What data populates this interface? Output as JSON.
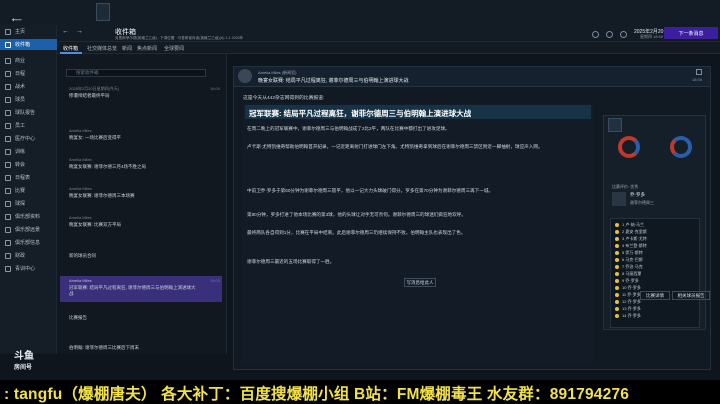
{
  "topbar": {
    "title": "收件箱",
    "subtitle": "克鲁斯菲尔德(英格兰乙级) - 下调位置 · 马鲁斯宣传者(英格兰乙级)(A) 1-1 2025年",
    "date": "2025年2月20日",
    "day": "星期四 18:00",
    "continue_label": "下一条消息"
  },
  "sidebar": {
    "items": [
      {
        "label": "主页"
      },
      {
        "label": "收件箱"
      },
      {
        "label": "商业"
      },
      {
        "label": "日程"
      },
      {
        "label": "战术"
      },
      {
        "label": "球员"
      },
      {
        "label": "球队报告"
      },
      {
        "label": "员工"
      },
      {
        "label": "医疗中心"
      },
      {
        "label": "训练"
      },
      {
        "label": "转会"
      },
      {
        "label": "日程表"
      },
      {
        "label": "比赛"
      },
      {
        "label": "球探"
      },
      {
        "label": "俱乐部资料"
      },
      {
        "label": "俱乐部远景"
      },
      {
        "label": "俱乐部信息"
      },
      {
        "label": "财政"
      },
      {
        "label": "青训中心"
      }
    ]
  },
  "tabs": [
    {
      "label": "收件箱"
    },
    {
      "label": "社交媒体总览"
    },
    {
      "label": "新闻"
    },
    {
      "label": "焦点新闻"
    },
    {
      "label": "全球要闻"
    }
  ],
  "list": {
    "search_placeholder": "搜索收件箱",
    "mails": [
      {
        "from": "2025年2月20日星期四(今天)",
        "subject": "惨遭缔结者最终平局",
        "time": "18:00"
      },
      {
        "from": "Amelia Miles",
        "subject": "晚宴女: 一场比赛后变得平",
        "time": ""
      },
      {
        "from": "Amelia Miles",
        "subject": "晚宴女联赛: 谢菲尔德三月4场不胜之局",
        "time": ""
      },
      {
        "from": "Amelia Miles",
        "subject": "晚宴女联赛: 谢菲尔德周三本场赛",
        "time": ""
      },
      {
        "from": "Amelia Miles",
        "subject": "晚宴女联赛: 比赛双方平局",
        "time": ""
      },
      {
        "from": "",
        "subject": "新的球员合同",
        "time": ""
      },
      {
        "from": "Amelia Miles",
        "subject": "冠军联赛: 结局平凡过程离狂, 谢菲尔德周三与伯明翰上演进球大战",
        "time": "18:00"
      },
      {
        "from": "",
        "subject": "比赛报告",
        "time": ""
      },
      {
        "from": "",
        "subject": "伯明翰: 谢菲尔德周三比赛后下周末",
        "time": ""
      }
    ]
  },
  "viewer": {
    "from": "Amelia Miles (新闻官)",
    "subject": "晚宴女联赛: 结局平凡过程离狂, 谢菲尔德周三与伯明翰上演进球大战",
    "time": "18:00",
    "intro": "这是今天从442杂志网得到的比赛报道:",
    "title": "冠军联赛: 结局平凡过程离狂，谢菲尔德周三与伯明翰上演进球大战",
    "paragraphs": [
      "在周二晚上的冠军联赛中，谢菲尔德周三与伯明翰战成了2比2平，两队在比赛中都打出了进攻足球。",
      "卢卡斯·尤特凯维奇帮助伯明翰首开纪录，一记近距离射门打进球门左下角。尤特凯维奇拿到球后在谢菲尔德周三禁区附近一脚抽射，球应声入网。",
      "中前卫乔·罗多于第60分钟为谢菲尔德周三扳平，他以一记大力头球破门得分。罗多在第70分钟为谢菲尔德周三再下一城。",
      "第80分钟，罗多打进了他本场比赛的第3球，他的头球让对手无可奈何。谢菲尔德周三的球迷们疯狂地欢呼。",
      "最终两队各自得到1分，比赛在平局中结束。此后谢菲尔德周三仍继续保持不败，伯明翰主队也表现出了色。",
      "谢菲尔德周三最近的五场比赛取得了一胜。"
    ],
    "reply_label": "写消息给此人",
    "footer": [
      "比赛详情",
      "相关球员报告"
    ]
  },
  "right_panel": {
    "club": "谢菲尔德周三",
    "match_label": "比赛评价: 优秀",
    "player_of_match": "乔·罗多",
    "lineup": [
      {
        "no": "1",
        "name": "卢·纳·马兰"
      },
      {
        "no": "2",
        "name": "夏安·克里斯"
      },
      {
        "no": "3",
        "name": "卢卡斯·尤特"
      },
      {
        "no": "4",
        "name": "布兰登·斯特"
      },
      {
        "no": "5",
        "name": "伊万·斯特"
      },
      {
        "no": "6",
        "name": "马克·巴斯"
      },
      {
        "no": "7",
        "name": "乔治·马克"
      },
      {
        "no": "8",
        "name": "马丽西蒙"
      },
      {
        "no": "9",
        "name": "乔·罗多"
      },
      {
        "no": "10",
        "name": "乔·罗多"
      },
      {
        "no": "11",
        "name": "乔·罗多"
      },
      {
        "no": "12",
        "name": "乔·罗多"
      },
      {
        "no": "13",
        "name": "乔·罗多"
      },
      {
        "no": "14",
        "name": "乔·罗多"
      }
    ]
  },
  "overlay": {
    "banner": ": tangfu（爆棚唐夫） 各大补丁：百度搜爆棚小组 B站：FM爆棚毒王 水友群：891794276",
    "watermark_name": "斗鱼",
    "watermark_sub": "房间号",
    "watermark_id": "7182875"
  }
}
